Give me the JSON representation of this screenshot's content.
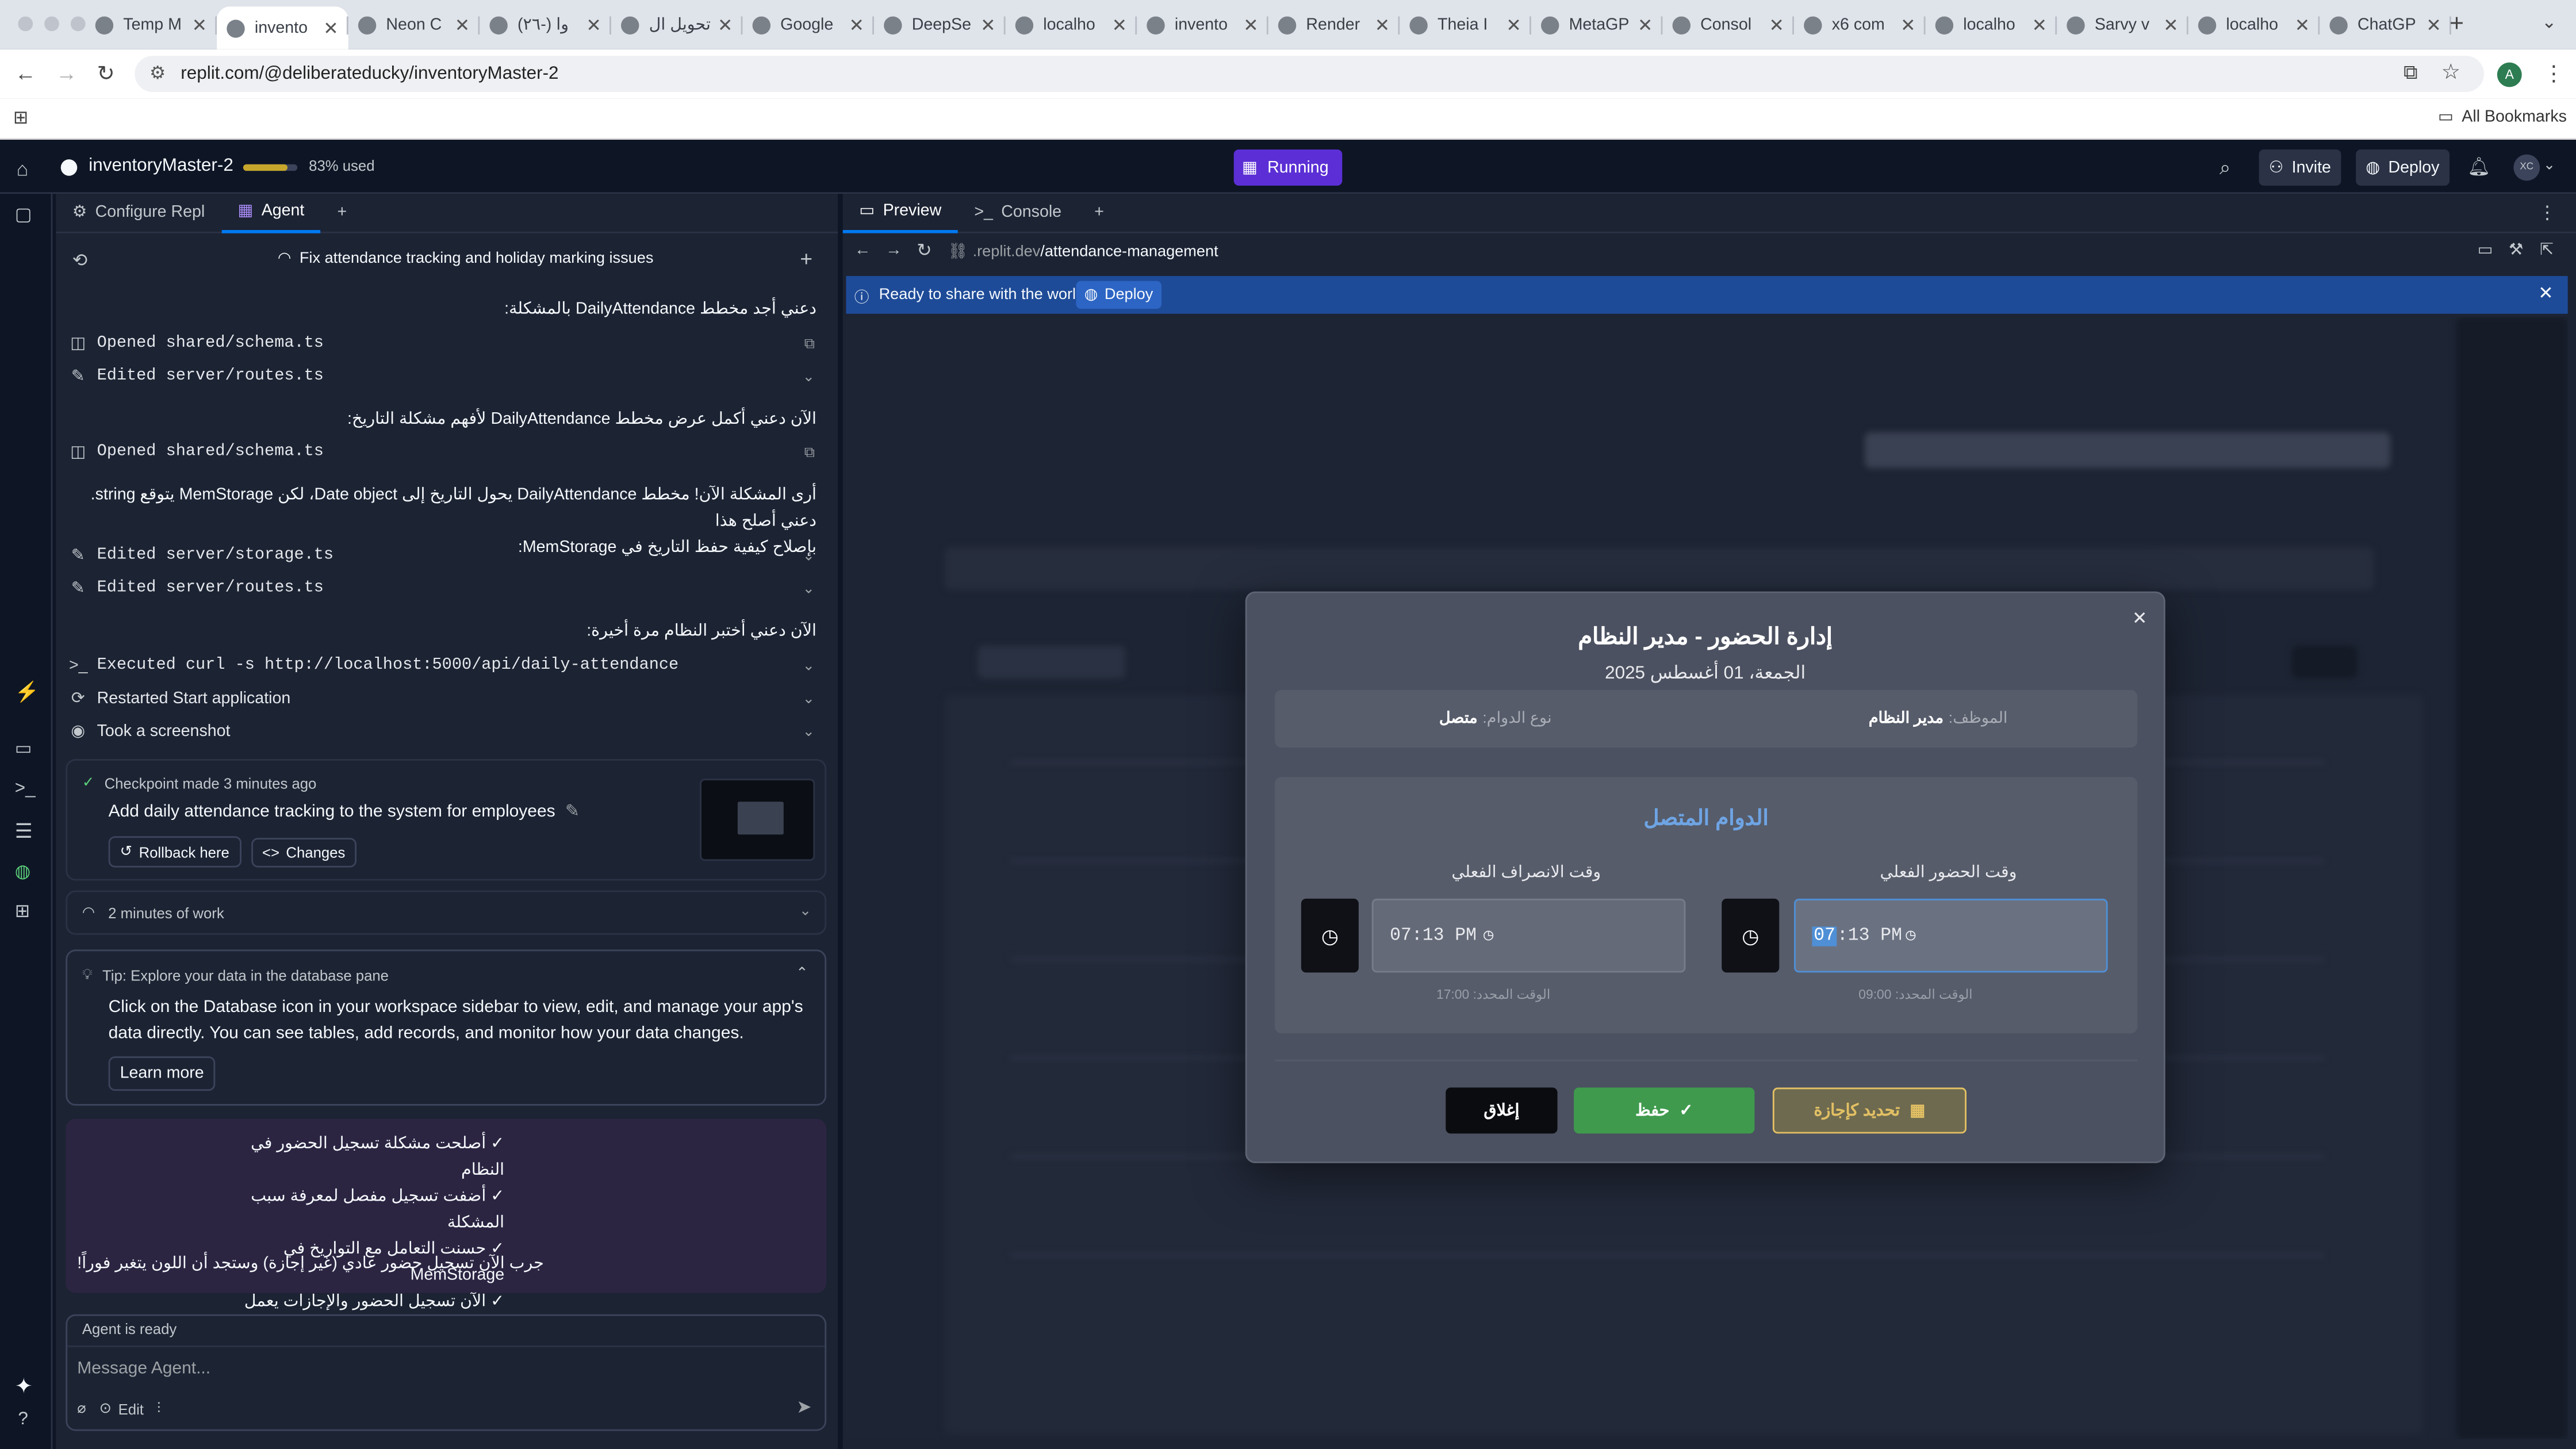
{
  "browser": {
    "tabs": [
      "Temp M",
      "invento",
      "Neon C",
      "(٢٦-) وا",
      "تحويل ال",
      "Google",
      "DeepSe",
      "localho",
      "invento",
      "Render",
      "Theia I",
      "MetaGP",
      "Consol",
      "x6 com",
      "localho",
      "Sarvy v",
      "localho",
      "ChatGP"
    ],
    "url": "replit.com/@deliberateducky/inventoryMaster-2",
    "all_bookmarks": "All Bookmarks",
    "profile_initial": "A"
  },
  "header": {
    "project_name": "inventoryMaster-2",
    "usage": "83% used",
    "usage_fraction": 0.83,
    "run_label": "Running",
    "invite": "Invite",
    "deploy": "Deploy",
    "avatar": "XC"
  },
  "left": {
    "tabs": [
      "Configure Repl",
      "Agent"
    ],
    "thread_title": "Fix attendance tracking and holiday marking issues",
    "msg1": "دعني أجد مخطط DailyAttendance بالمشكلة:",
    "act1": "Opened shared/schema.ts",
    "act2": "Edited server/routes.ts",
    "msg2": "الآن دعني أكمل عرض مخطط DailyAttendance لأفهم مشكلة التاريخ:",
    "act3": "Opened shared/schema.ts",
    "msg3a": "أرى المشكلة الآن! مخطط DailyAttendance يحول التاريخ إلى Date object، لكن MemStorage يتوقع string. دعني أصلح هذا",
    "msg3b": "بإصلاح كيفية حفظ التاريخ في MemStorage:",
    "act4": "Edited server/storage.ts",
    "act5": "Edited server/routes.ts",
    "msg4": "الآن دعني أختبر النظام مرة أخيرة:",
    "act6": "Executed curl -s http://localhost:5000/api/daily-attendance",
    "act7": "Restarted Start application",
    "act8": "Took a screenshot",
    "checkpoint_time": "Checkpoint made 3 minutes ago",
    "checkpoint_title": "Add daily attendance tracking to the system for employees",
    "rollback": "Rollback here",
    "changes": "Changes",
    "work_time": "2 minutes of work",
    "tip_title": "Tip: Explore your data in the database pane",
    "tip_body": "Click on the Database icon in your workspace sidebar to view, edit, and manage your app's data directly. You can see tables, add records, and monitor how your data changes.",
    "learn_more": "Learn more",
    "summary": [
      "✓ أصلحت مشكلة تسجيل الحضور في النظام",
      "✓ أضفت تسجيل مفصل لمعرفة سبب المشكلة",
      "✓ حسنت التعامل مع التواريخ في MemStorage",
      "✓ الآن تسجيل الحضور والإجازات يعمل بشكل صحيح"
    ],
    "summary_end": "!جرب الآن تسجيل حضور عادي (غير إجازة) وستجد أن اللون يتغير فوراً",
    "agent_status": "Agent is ready",
    "input_placeholder": "Message Agent...",
    "edit": "Edit"
  },
  "preview": {
    "tabs": [
      "Preview",
      "Console"
    ],
    "url_prefix": ".replit.dev",
    "url_path": "/attendance-management",
    "banner": "Ready to share with the world?",
    "banner_btn": "Deploy"
  },
  "modal": {
    "title": "إدارة الحضور - مدير النظام",
    "date": "الجمعة، 01 أغسطس 2025",
    "employee_label": "الموظف:",
    "employee_value": "مدير النظام",
    "shift_label": "نوع الدوام:",
    "shift_value": "متصل",
    "section_title": "الدوام المتصل",
    "checkin_label": "وقت الحضور الفعلي",
    "checkout_label": "وقت الانصراف الفعلي",
    "checkin_hour": "07",
    "checkin_rest": ":13 PM",
    "checkout_time": "07:13 PM",
    "checkin_expected": "الوقت المحدد: 09:00",
    "checkout_expected": "الوقت المحدد: 17:00",
    "btn_holiday": "تحديد كإجازة",
    "btn_save": "حفظ",
    "btn_close": "إغلاق",
    "colors": {
      "holiday": "#e2c064",
      "save": "#3f9a4d",
      "close": "#0b0c10",
      "accent": "#4f8fd6"
    }
  }
}
